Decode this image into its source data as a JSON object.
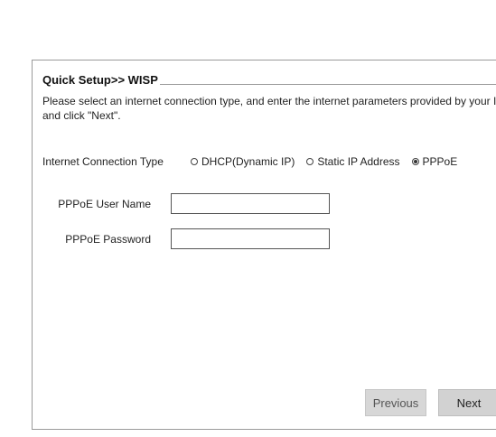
{
  "header": {
    "title": "Quick Setup>> WISP"
  },
  "description": "Please select an internet connection type, and enter the internet parameters provided by your ISP\nand click \"Next\".",
  "connection": {
    "label": "Internet Connection Type",
    "options": [
      {
        "label": "DHCP(Dynamic IP)",
        "selected": false
      },
      {
        "label": "Static IP Address",
        "selected": false
      },
      {
        "label": "PPPoE",
        "selected": true
      }
    ]
  },
  "fields": {
    "username": {
      "label": "PPPoE User Name",
      "value": ""
    },
    "password": {
      "label": "PPPoE Password",
      "value": ""
    }
  },
  "buttons": {
    "previous": "Previous",
    "next": "Next"
  },
  "colors": {
    "border": "#9a9a9a",
    "button_bg": "#d7d7d7"
  }
}
